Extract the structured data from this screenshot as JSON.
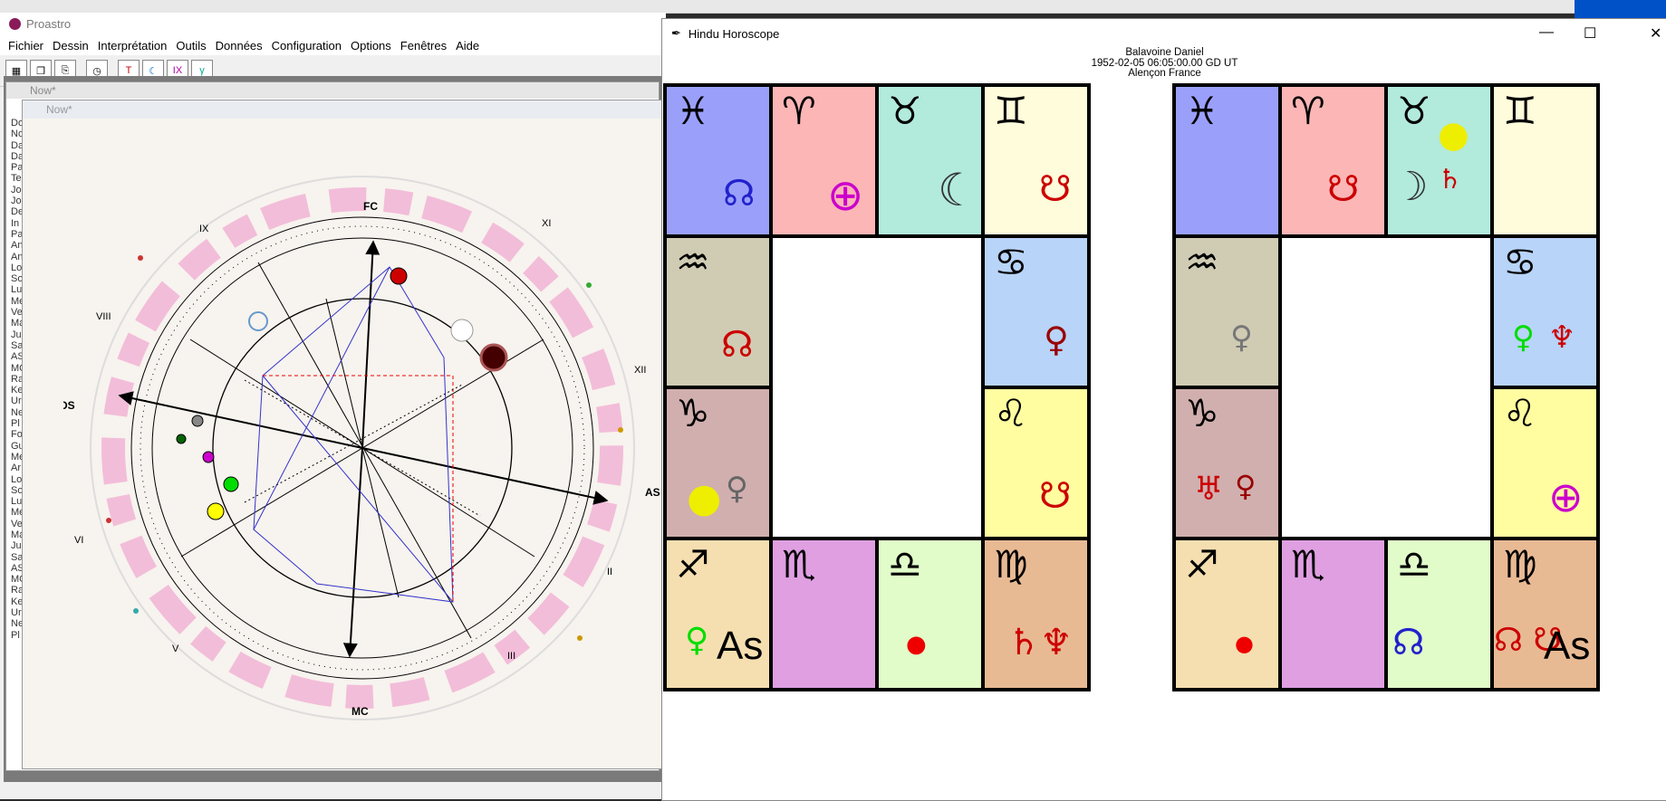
{
  "background": {
    "top_strip_color": "#e8e8e8",
    "accent_blue": "#0050c8"
  },
  "proastro": {
    "title": "Proastro",
    "menu": [
      "Fichier",
      "Dessin",
      "Interprétation",
      "Outils",
      "Données",
      "Configuration",
      "Options",
      "Fenêtres",
      "Aide"
    ],
    "toolbar_icons": [
      "calculator-icon",
      "copy-chart-icon",
      "transfer-icon",
      "clock-icon",
      "transit-icon",
      "progression-icon",
      "solar-arc-icon",
      "gamma-icon"
    ],
    "child_window_back": {
      "title": "Now*"
    },
    "child_window_front": {
      "title": "Now*"
    },
    "left_list": [
      "Do",
      "No",
      "Da",
      "Da",
      "Pa",
      "Te",
      "Jo",
      "Jo",
      "De",
      "In",
      "Pa",
      "An",
      "An",
      "Lo",
      "So",
      "Lu",
      "Me",
      "Ve",
      "Ma",
      "Ju",
      "Sa",
      "AS",
      "MC",
      "Ra",
      "Ke",
      "Ur",
      "Ne",
      "Pl",
      "Fo",
      "Gu",
      "Me",
      "Ar",
      "Lo",
      "So",
      "Lu",
      "Me",
      "Ve",
      "Ma",
      "Ju",
      "Sa",
      "AS",
      "MC",
      "Ra",
      "Ke",
      "Ur",
      "Ne",
      "Pl"
    ],
    "chart": {
      "axes": {
        "fc": "FC",
        "mc": "MC",
        "ds": "DS",
        "as": "AS"
      },
      "houses": [
        "IX",
        "VIII",
        "VI",
        "V",
        "III",
        "II",
        "XI",
        "XII"
      ]
    }
  },
  "hindu": {
    "title": "Hindu Horoscope",
    "header": {
      "name": "Balavoine Daniel",
      "datetime": "1952-02-05 06:05:00.00 GD UT",
      "place": "Alençon France"
    },
    "controls": {
      "minimize": "—",
      "maximize": "☐",
      "close": "✕"
    },
    "asc_label": "As",
    "colors": {
      "pisces": "#9aa0fa",
      "aries": "#fcb6b6",
      "taurus": "#b2eadc",
      "gemini": "#fffcdb",
      "aquarius": "#d0ccb4",
      "cancer": "#b8d4f8",
      "capricorn": "#d1afaf",
      "leo": "#fffda0",
      "sagittarius": "#f5dfb0",
      "scorpio": "#df9fe1",
      "libra": "#e1fcc9",
      "virgo": "#e8ba94"
    }
  }
}
